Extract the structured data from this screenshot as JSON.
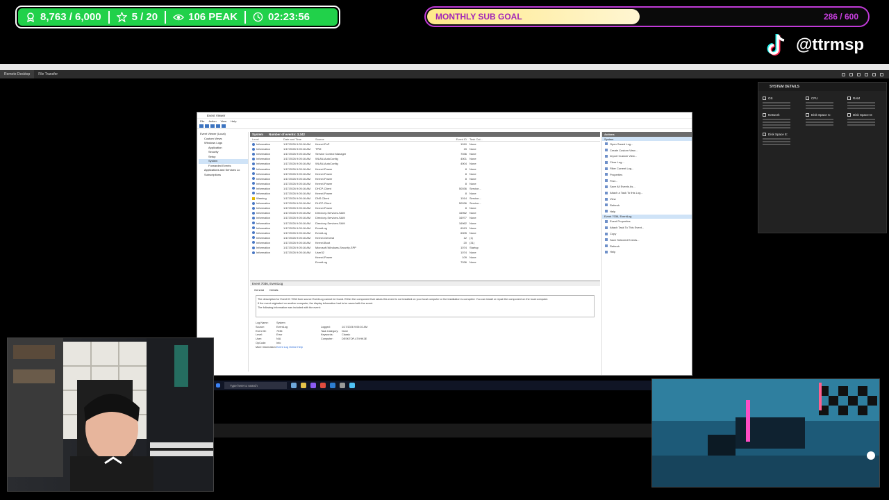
{
  "stats": {
    "followers": "8,763 / 6,000",
    "stars": "5 / 20",
    "peak": "106 PEAK",
    "timer": "02:23:56"
  },
  "sub_goal": {
    "label": "MONTHLY SUB GOAL",
    "count": "286 / 600",
    "progress": 0.477
  },
  "tiktok": {
    "handle": "@ttrmsp"
  },
  "remote_desktop": {
    "tabs": [
      "Remote Desktop",
      "File Transfer"
    ]
  },
  "system_details": {
    "title": "SYSTEM DETAILS",
    "tiles": [
      "OS",
      "CPU",
      "RAM",
      "Network",
      "Disk Space C:",
      "Disk Space D:",
      "Disk Space E:"
    ]
  },
  "event_viewer": {
    "title": "Event Viewer",
    "menu": [
      "File",
      "Action",
      "View",
      "Help"
    ],
    "tree": [
      "Event Viewer (Local)",
      "Custom Views",
      "Windows Logs",
      "Application",
      "Security",
      "Setup",
      "System",
      "Forwarded Events",
      "Applications and Services Lo",
      "Subscriptions"
    ],
    "list_title": "System",
    "list_count": "Number of events: 3,342",
    "columns": [
      "Level",
      "Date and Time",
      "Source",
      "Event ID",
      "Task Cat..."
    ],
    "rows": [
      {
        "level": "Information",
        "date": "1/17/2026 9:05:16 AM",
        "source": "Kernel-PnP",
        "id": "1010",
        "cat": "None",
        "warn": false
      },
      {
        "level": "Information",
        "date": "1/17/2026 9:05:16 AM",
        "source": "TPM",
        "id": "15",
        "cat": "None",
        "warn": false
      },
      {
        "level": "Information",
        "date": "1/17/2026 9:05:16 AM",
        "source": "Service Control Manager",
        "id": "7036",
        "cat": "None",
        "warn": false
      },
      {
        "level": "Information",
        "date": "1/17/2026 9:05:16 AM",
        "source": "WLAN-AutoConfig",
        "id": "4001",
        "cat": "None",
        "warn": false
      },
      {
        "level": "Information",
        "date": "1/17/2026 9:05:16 AM",
        "source": "WLAN-AutoConfig",
        "id": "4004",
        "cat": "None",
        "warn": false
      },
      {
        "level": "Information",
        "date": "1/17/2026 9:05:16 AM",
        "source": "Kernel-Power",
        "id": "8",
        "cat": "None",
        "warn": false
      },
      {
        "level": "Information",
        "date": "1/17/2026 9:05:16 AM",
        "source": "Kernel-Power",
        "id": "8",
        "cat": "None",
        "warn": false
      },
      {
        "level": "Information",
        "date": "1/17/2026 9:05:16 AM",
        "source": "Kernel-Power",
        "id": "8",
        "cat": "None",
        "warn": false
      },
      {
        "level": "Information",
        "date": "1/17/2026 9:05:16 AM",
        "source": "Kernel-Power",
        "id": "8",
        "cat": "None",
        "warn": false
      },
      {
        "level": "Information",
        "date": "1/17/2026 9:05:16 AM",
        "source": "DHCP-Client",
        "id": "50036",
        "cat": "Service...",
        "warn": false
      },
      {
        "level": "Information",
        "date": "1/17/2026 9:05:16 AM",
        "source": "Kernel-Power",
        "id": "8",
        "cat": "None",
        "warn": false
      },
      {
        "level": "Warning",
        "date": "1/17/2026 9:05:16 AM",
        "source": "DNS Client",
        "id": "1014",
        "cat": "Service...",
        "warn": true
      },
      {
        "level": "Information",
        "date": "1/17/2026 9:05:16 AM",
        "source": "DHCP-Client",
        "id": "50036",
        "cat": "Service...",
        "warn": false
      },
      {
        "level": "Information",
        "date": "1/17/2026 9:05:16 AM",
        "source": "Kernel-Power",
        "id": "8",
        "cat": "None",
        "warn": false
      },
      {
        "level": "Information",
        "date": "1/17/2026 9:05:16 AM",
        "source": "Directory-Services-SAM",
        "id": "16962",
        "cat": "None",
        "warn": false
      },
      {
        "level": "Information",
        "date": "1/17/2026 9:05:16 AM",
        "source": "Directory-Services-SAM",
        "id": "16977",
        "cat": "None",
        "warn": false
      },
      {
        "level": "Information",
        "date": "1/17/2026 9:05:16 AM",
        "source": "Directory-Services-SAM",
        "id": "16962",
        "cat": "None",
        "warn": false
      },
      {
        "level": "Information",
        "date": "1/17/2026 9:05:16 AM",
        "source": "EventLog",
        "id": "6013",
        "cat": "None",
        "warn": false
      },
      {
        "level": "Information",
        "date": "1/17/2026 9:05:16 AM",
        "source": "EventLog",
        "id": "6005",
        "cat": "None",
        "warn": false
      },
      {
        "level": "Information",
        "date": "1/17/2026 9:05:16 AM",
        "source": "Kernel-General",
        "id": "12",
        "cat": "(1)",
        "warn": false
      },
      {
        "level": "Information",
        "date": "1/17/2026 9:05:16 AM",
        "source": "Kernel-Boot",
        "id": "20",
        "cat": "(31)",
        "warn": false
      },
      {
        "level": "Information",
        "date": "1/17/2026 9:05:16 AM",
        "source": "Microsoft-Windows-Security-SPP",
        "id": "1074",
        "cat": "Startup",
        "warn": false
      },
      {
        "level": "Information",
        "date": "1/17/2026 9:05:16 AM",
        "source": "User32",
        "id": "1074",
        "cat": "None",
        "warn": false
      },
      {
        "level": "",
        "date": "",
        "source": "Kernel-Power",
        "id": "109",
        "cat": "None",
        "warn": false
      },
      {
        "level": "",
        "date": "",
        "source": "EventLog",
        "id": "7036",
        "cat": "None",
        "warn": false
      }
    ],
    "detail_title": "Event 7036, EventLog",
    "detail_tabs": [
      "General",
      "Details"
    ],
    "detail_text": "The description for Event ID 7036 from source EventLog cannot be found. Either the component that raises this event is not installed on your local computer or the installation is corrupted. You can install or repair the component on the local computer.",
    "detail_text2": "If the event originated on another computer, the display information had to be saved with the event.",
    "detail_text3": "The following information was included with the event:",
    "fields": [
      [
        "Log Name:",
        "System",
        "",
        ""
      ],
      [
        "Source:",
        "EventLog",
        "Logged:",
        "1/17/2026 9:05:02 AM"
      ],
      [
        "Event ID:",
        "7036",
        "Task Category:",
        "None"
      ],
      [
        "Level:",
        "Error",
        "Keywords:",
        "Classic"
      ],
      [
        "User:",
        "N/A",
        "Computer:",
        "DESKTOP-4TVHK3E"
      ],
      [
        "OpCode:",
        "Info",
        "",
        ""
      ],
      [
        "More Information:",
        "Event Log Online Help",
        "",
        ""
      ]
    ],
    "actions_title": "Actions",
    "actions_sub1": "System",
    "actions1": [
      "Open Saved Log...",
      "Create Custom View...",
      "Import Custom View...",
      "Clear Log...",
      "Filter Current Log...",
      "Properties",
      "Find...",
      "Save All Events As...",
      "Attach a Task To this Log...",
      "View",
      "Refresh",
      "Help"
    ],
    "actions_sub2": "Event 7036, EventLog",
    "actions2": [
      "Event Properties",
      "Attach Task To This Event...",
      "Copy",
      "Save Selected Events...",
      "Refresh",
      "Help"
    ]
  },
  "taskbar": {
    "search_placeholder": "Type here to search"
  },
  "colors": {
    "stats_green": "#21d14a",
    "goal_purple": "#c13ad8",
    "goal_fill": "#ffe98a"
  }
}
